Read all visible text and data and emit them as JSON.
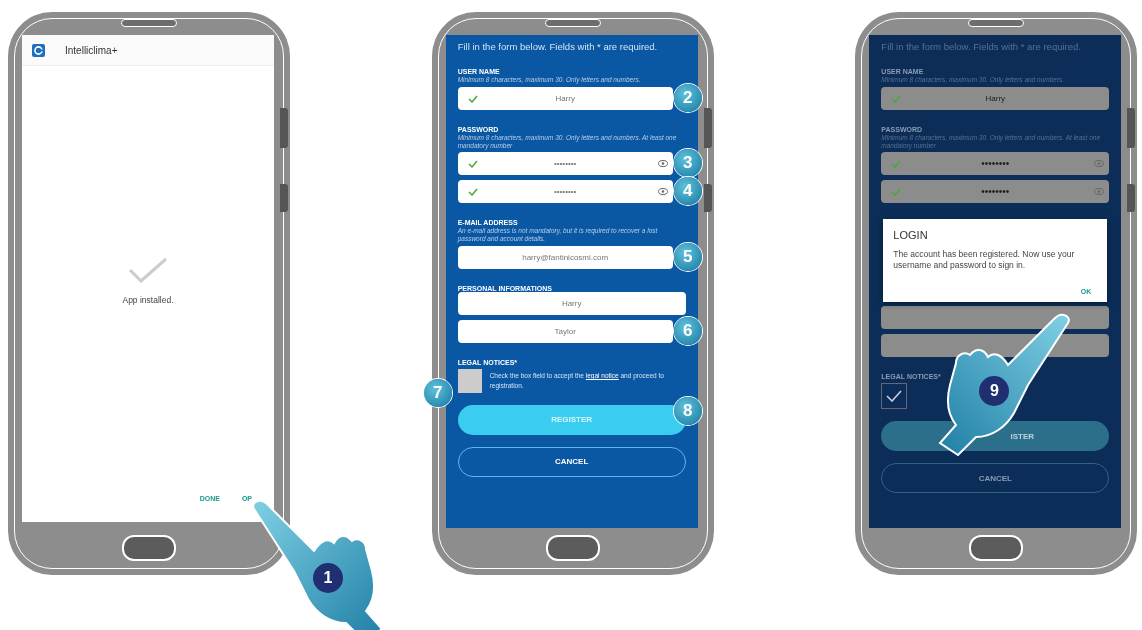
{
  "phones": [
    {
      "kind": "installed",
      "app_name": "Intelliclima+",
      "message": "App installed.",
      "actions": [
        "DONE",
        "OP"
      ],
      "hand": {
        "callout": "1"
      }
    },
    {
      "kind": "form",
      "dimmed": false,
      "intro": "Fill in the form below. Fields with * are required.",
      "sections": [
        {
          "title": "USER NAME",
          "hint": "Minimum 8 characters, maximum 30. Only letters and numbers.",
          "fields": [
            {
              "value": "Harry",
              "valid": true,
              "eye": false,
              "callout": "2"
            }
          ]
        },
        {
          "title": "PASSWORD",
          "hint": "Minimum 8 characters, maximum 30. Only letters and numbers. At least one mandatory number",
          "fields": [
            {
              "value": "••••••••",
              "valid": true,
              "eye": true,
              "callout": "3"
            },
            {
              "value": "••••••••",
              "valid": true,
              "eye": true,
              "callout": "4"
            }
          ]
        },
        {
          "title": "E-MAIL ADDRESS",
          "hint": "An e-mail address is not mandatory, but it is required to recover a lost password and account details.",
          "fields": [
            {
              "value": "harry@fantinicosmi.com",
              "valid": false,
              "eye": false,
              "callout": "5"
            }
          ]
        },
        {
          "title": "PERSONAL INFORMATIONS",
          "fields": [
            {
              "value": "Harry",
              "valid": false,
              "eye": false
            },
            {
              "value": "Taylor",
              "valid": false,
              "eye": false,
              "callout": "6"
            }
          ]
        }
      ],
      "legal": {
        "title": "LEGAL NOTICES*",
        "text_before": "Check the box field to accept the",
        "link": "legal notice",
        "text_after": "and proceed to registration.",
        "checked": false,
        "callout": "7"
      },
      "register": {
        "label": "REGISTER",
        "callout": "8"
      },
      "cancel": "CANCEL"
    },
    {
      "kind": "form",
      "dimmed": true,
      "intro": "Fill in the form below. Fields with * are required.",
      "sections": [
        {
          "title": "USER NAME",
          "hint": "Minimum 8 characters, maximum 30. Only letters and numbers.",
          "fields": [
            {
              "value": "Harry",
              "valid": true,
              "eye": false
            }
          ]
        },
        {
          "title": "PASSWORD",
          "hint": "Minimum 8 characters, maximum 30. Only letters and numbers. At least one mandatory number",
          "fields": [
            {
              "value": "••••••••",
              "valid": true,
              "eye": true
            },
            {
              "value": "••••••••",
              "valid": true,
              "eye": true
            }
          ]
        }
      ],
      "dialog": {
        "title": "LOGIN",
        "message": "The account has been registered. Now use your username and password to sign in.",
        "ok": "OK"
      },
      "after_sections": [
        {
          "fields": [
            {
              "valid": false,
              "eye": false
            },
            {
              "valid": false,
              "eye": false
            }
          ]
        }
      ],
      "legal": {
        "title": "LEGAL NOTICES*",
        "checked": true
      },
      "register": {
        "label": "ISTER"
      },
      "cancel": "CANCEL",
      "hand": {
        "callout": "9"
      }
    }
  ]
}
